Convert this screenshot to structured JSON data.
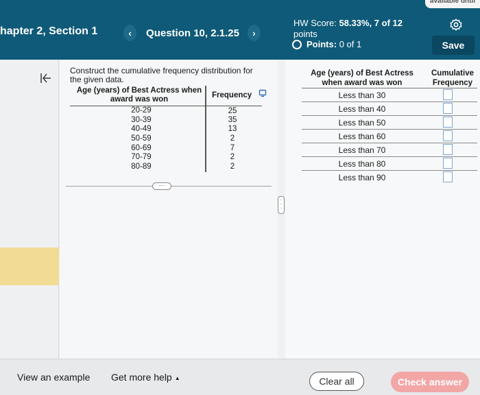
{
  "header": {
    "available_tab": "available until",
    "chapter_title": "hapter 2, Section 1",
    "prev_icon": "chevron-left-icon",
    "next_icon": "chevron-right-icon",
    "question_label": "Question 10, 2.1.25",
    "hw_score_label": "HW Score:",
    "hw_score_value": "58.33%, 7 of 12",
    "hw_score_suffix": "points",
    "points_label": "Points:",
    "points_value": "0 of 1",
    "settings_icon": "gear-icon",
    "save_label": "Save",
    "colors": {
      "bar": "#0f5a78",
      "save": "#0b4760"
    }
  },
  "left_panel": {
    "instructions": "Construct the cumulative frequency distribution for the given data.",
    "table": {
      "col1_header": "Age (years) of Best Actress when award was won",
      "col2_header": "Frequency",
      "rows": [
        {
          "range": "20-29",
          "freq": "25"
        },
        {
          "range": "30-39",
          "freq": "35"
        },
        {
          "range": "40-49",
          "freq": "13"
        },
        {
          "range": "50-59",
          "freq": "2"
        },
        {
          "range": "60-69",
          "freq": "7"
        },
        {
          "range": "70-79",
          "freq": "2"
        },
        {
          "range": "80-89",
          "freq": "2"
        }
      ]
    }
  },
  "answer_table": {
    "col1_header": "Age (years) of Best Actress when award was won",
    "col2_header": "Cumulative Frequency",
    "rows": [
      {
        "label": "Less than 30",
        "value": ""
      },
      {
        "label": "Less than 40",
        "value": ""
      },
      {
        "label": "Less than 50",
        "value": ""
      },
      {
        "label": "Less than 60",
        "value": ""
      },
      {
        "label": "Less than 70",
        "value": ""
      },
      {
        "label": "Less than 80",
        "value": ""
      },
      {
        "label": "Less than 90",
        "value": ""
      }
    ]
  },
  "footer": {
    "view_example": "View an example",
    "get_help": "Get more help",
    "clear_all": "Clear all",
    "check_answer": "Check answer",
    "colors": {
      "check": "#f2a6a6"
    }
  }
}
